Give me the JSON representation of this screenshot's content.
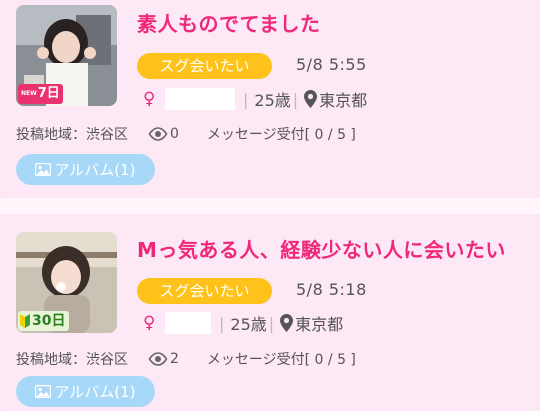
{
  "posts": [
    {
      "title": "素人ものでてました",
      "badge": "スグ会いたい",
      "time": "5/8 5:55",
      "gender_symbol": "♀",
      "age": "25歳",
      "location": "東京都",
      "area": "投稿地域：渋谷区",
      "views": "0",
      "messages": "メッセージ受付[ 0 / 5 ]",
      "album": "アルバム(1)",
      "thumb_badge": "7日",
      "thumb_badge_tag": "NEW"
    },
    {
      "title": "Mっ気ある人、経験少ない人に会いたい",
      "badge": "スグ会いたい",
      "time": "5/8 5:18",
      "gender_symbol": "♀",
      "age": "25歳",
      "location": "東京都",
      "area": "投稿地域：渋谷区",
      "views": "2",
      "messages": "メッセージ受付[ 0 / 5 ]",
      "album": "アルバム(1)",
      "thumb_badge": "30日"
    }
  ],
  "colors": {
    "card_bg": "#fde8f5",
    "title": "#f0287a",
    "badge": "#ffc21a",
    "album_button": "#a8d8f8"
  }
}
